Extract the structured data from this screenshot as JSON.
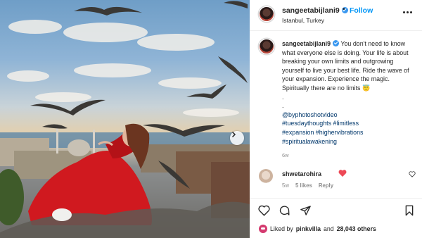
{
  "post": {
    "username": "sangeetabijlani9",
    "dot": "•",
    "follow_label": "Follow",
    "location": "Istanbul, Turkey"
  },
  "caption": {
    "username": "sangeetabijlani9",
    "text": "You don't need to know what everyone else is doing. Your life is about breaking your own limits and outgrowing yourself to live your best life. Ride the wave of your expansion. Experience the magic. Spiritually there are no limits",
    "emoji": "😇",
    "dot1": ".",
    "dot2": ".",
    "mention": "@byphotoshotvideo",
    "hashtags": [
      "#tuesdaythoughts",
      "#limitless",
      "#expansion",
      "#highervibrations",
      "#spiritualawakening"
    ],
    "time": "6w"
  },
  "comment": {
    "username": "shwetarohira",
    "time": "5w",
    "likes": "5 likes",
    "reply": "Reply"
  },
  "likes": {
    "prefix": "Liked by",
    "user": "pinkvilla",
    "conj": "and",
    "count": "28,043 others"
  },
  "icons": {
    "more": "more-horizontal-icon",
    "verified": "verified-badge-icon",
    "like": "heart-outline-icon",
    "comment": "comment-bubble-icon",
    "share": "paper-plane-icon",
    "save": "bookmark-icon",
    "next": "chevron-right-icon"
  },
  "colors": {
    "follow": "#0095f6",
    "verified": "#3897f0",
    "hashtag": "#00376b",
    "muted": "#8e8e8e",
    "heart": "#ed4956",
    "dress": "#d0191f"
  }
}
